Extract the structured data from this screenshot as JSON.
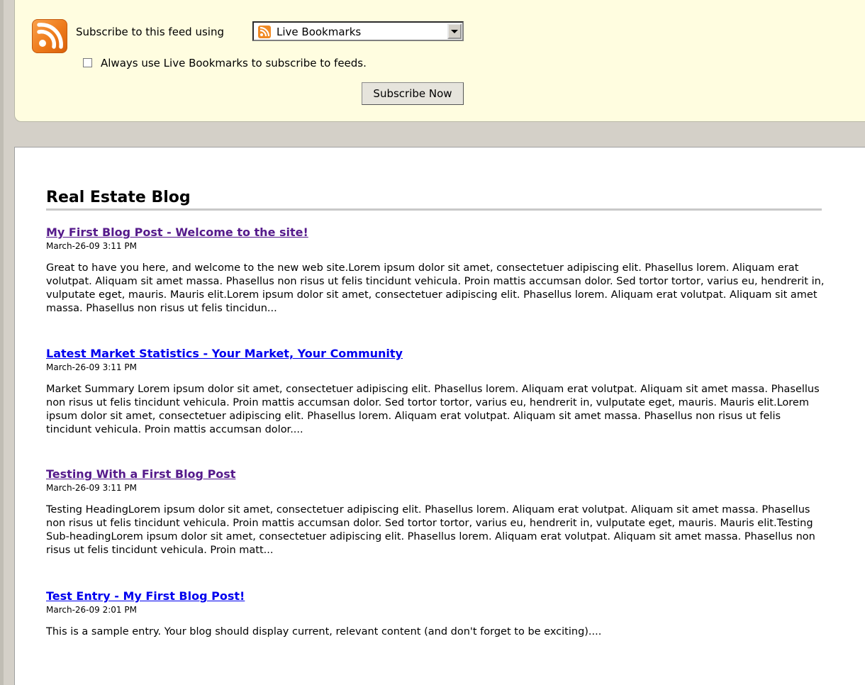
{
  "subscribe": {
    "label": "Subscribe to this feed using",
    "selected_reader": "Live Bookmarks",
    "always_use_label": "Always use Live Bookmarks to subscribe to feeds.",
    "always_use_checked": false,
    "button_label": "Subscribe Now"
  },
  "blog": {
    "title": "Real Estate Blog",
    "entries": [
      {
        "title": "My First Blog Post - Welcome to the site!",
        "date": "March-26-09 3:11 PM",
        "visited": true,
        "summary": "Great to have you here, and welcome to the new web site.Lorem ipsum dolor sit amet, consectetuer adipiscing elit. Phasellus lorem. Aliquam erat volutpat. Aliquam sit amet massa. Phasellus non risus ut felis tincidunt vehicula. Proin mattis accumsan dolor. Sed tortor tortor, varius eu, hendrerit in, vulputate eget, mauris. Mauris elit.Lorem ipsum dolor sit amet, consectetuer adipiscing elit. Phasellus lorem. Aliquam erat volutpat. Aliquam sit amet massa. Phasellus non risus ut felis tincidun..."
      },
      {
        "title": "Latest Market Statistics - Your Market, Your Community",
        "date": "March-26-09 3:11 PM",
        "visited": false,
        "summary": "Market Summary Lorem ipsum dolor sit amet, consectetuer adipiscing elit. Phasellus lorem. Aliquam erat volutpat. Aliquam sit amet massa. Phasellus non risus ut felis tincidunt vehicula. Proin mattis accumsan dolor. Sed tortor tortor, varius eu, hendrerit in, vulputate eget, mauris. Mauris elit.Lorem ipsum dolor sit amet, consectetuer adipiscing elit. Phasellus lorem. Aliquam erat volutpat. Aliquam sit amet massa. Phasellus non risus ut felis tincidunt vehicula. Proin mattis accumsan dolor...."
      },
      {
        "title": "Testing With a First Blog Post",
        "date": "March-26-09 3:11 PM",
        "visited": true,
        "summary": "Testing HeadingLorem ipsum dolor sit amet, consectetuer adipiscing elit. Phasellus lorem. Aliquam erat volutpat. Aliquam sit amet massa. Phasellus non risus ut felis tincidunt vehicula. Proin mattis accumsan dolor. Sed tortor tortor, varius eu, hendrerit in, vulputate eget, mauris. Mauris elit.Testing Sub-headingLorem ipsum dolor sit amet, consectetuer adipiscing elit. Phasellus lorem. Aliquam erat volutpat. Aliquam sit amet massa. Phasellus non risus ut felis tincidunt vehicula. Proin matt..."
      },
      {
        "title": "Test Entry - My First Blog Post!",
        "date": "March-26-09 2:01 PM",
        "visited": false,
        "summary": "This is a sample entry.  Your blog should display current, relevant content (and don't forget to be exciting)...."
      }
    ]
  },
  "colors": {
    "visited_link": "#551a8b",
    "unvisited_link": "#0000ee",
    "subscribe_bg": "#fffde0",
    "rss_orange": "#ee7a1b"
  },
  "icons": [
    "rss-feed-icon",
    "live-bookmarks-icon",
    "dropdown-arrow-icon"
  ]
}
